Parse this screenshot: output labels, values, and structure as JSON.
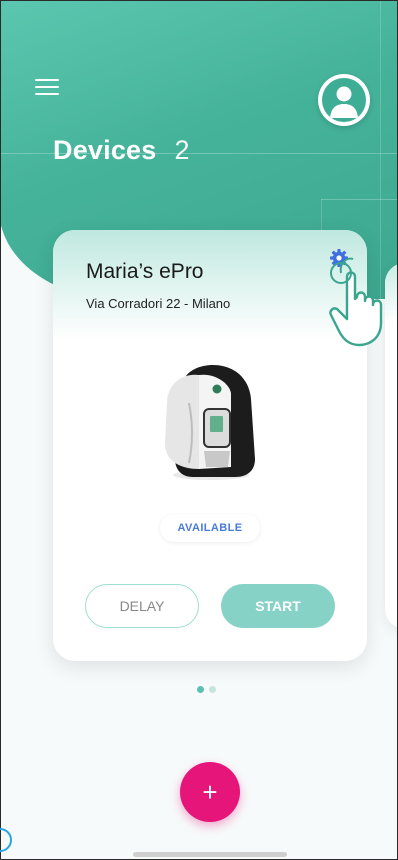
{
  "header": {
    "title": "Devices",
    "device_count": "2",
    "menu_icon": "hamburger-menu-icon",
    "profile_icon": "user-avatar-icon"
  },
  "device_card": {
    "name": "Maria’s ePro",
    "address": "Via Corradori 22 - Milano",
    "status": "AVAILABLE",
    "settings_icon": "gear-icon",
    "delay_label": "DELAY",
    "start_label": "START"
  },
  "pagination": {
    "total": 2,
    "active": 0
  },
  "fab": {
    "label": "+"
  },
  "colors": {
    "header_teal": "#45b39a",
    "status_blue": "#4a7bd8",
    "start_button": "#86d2c7",
    "fab_pink": "#e5157a",
    "dot_active": "#5cc0b4",
    "dot_inactive": "#c4e6df"
  }
}
